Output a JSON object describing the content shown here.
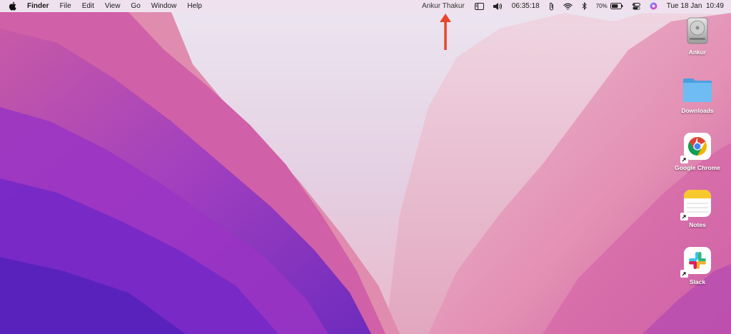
{
  "menubar": {
    "app_name": "Finder",
    "items": [
      "File",
      "Edit",
      "View",
      "Go",
      "Window",
      "Help"
    ],
    "user_name": "Ankur Thakur",
    "timer": "06:35:18",
    "battery_percent": "70%",
    "datetime": "Tue 18 Jan  10:49"
  },
  "desktop": {
    "icons": [
      {
        "label": "Ankur",
        "kind": "hard-drive-icon"
      },
      {
        "label": "Downloads",
        "kind": "folder-icon"
      },
      {
        "label": "Google Chrome",
        "kind": "chrome-icon"
      },
      {
        "label": "Notes",
        "kind": "notes-icon"
      },
      {
        "label": "Slack",
        "kind": "slack-icon"
      }
    ]
  },
  "colors": {
    "annotation_arrow": "#e8452a",
    "folder_blue": "#5fb2ee",
    "notes_yellow": "#f8c92c"
  }
}
